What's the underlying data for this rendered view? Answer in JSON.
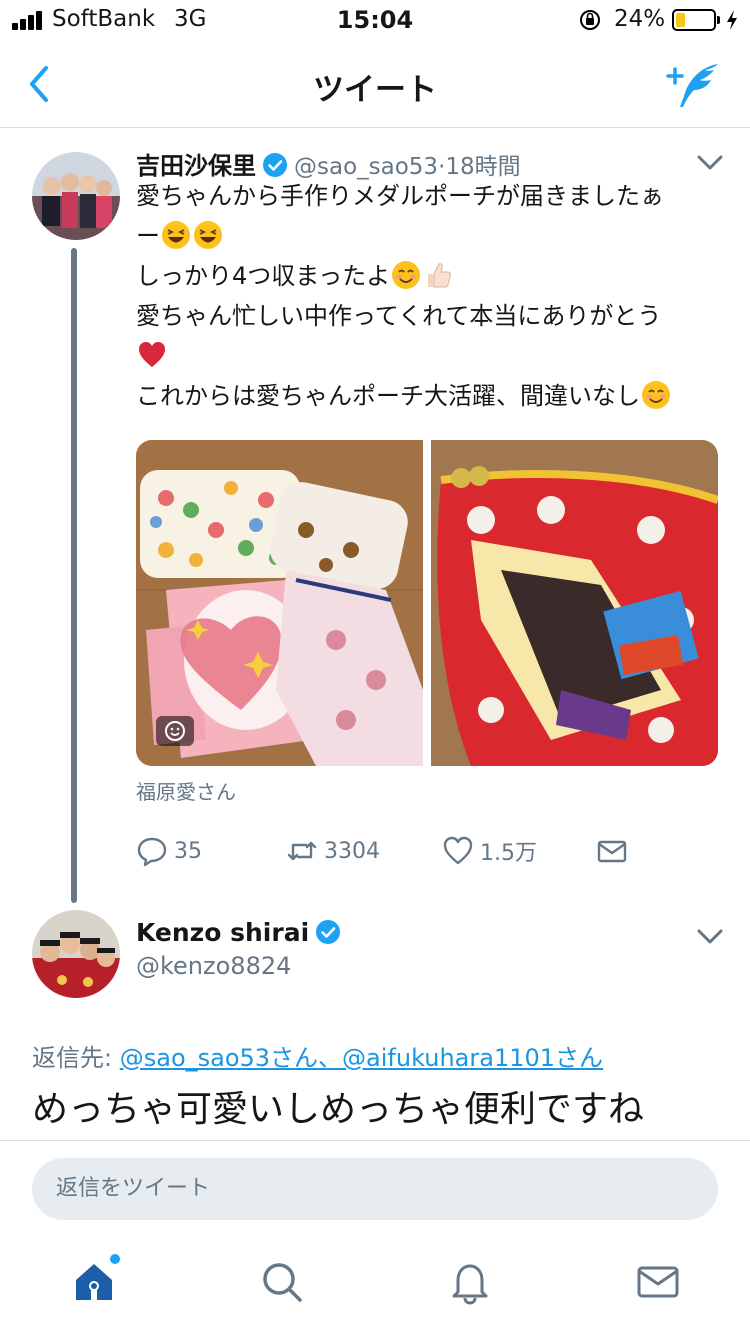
{
  "status_bar": {
    "carrier": "SoftBank",
    "network": "3G",
    "time": "15:04",
    "battery_percent": "24%",
    "battery_level": 0.24
  },
  "nav": {
    "title": "ツイート",
    "back_icon": "chevron-left-icon",
    "compose_icon": "compose-tweet-icon"
  },
  "tweet": {
    "author_name": "吉田沙保里",
    "handle": "@sao_sao53",
    "time_ago": "·18時間",
    "lines": [
      "愛ちゃんから手作りメダルポーチが届きましたぁ",
      "ー",
      "しっかり4つ収まったよ",
      "愛ちゃん忙しい中作ってくれて本当にありがとう",
      "",
      "これからは愛ちゃんポーチ大活躍、間違いなし"
    ],
    "tagged": "福原愛さん",
    "stats": {
      "replies": "35",
      "retweets": "3304",
      "likes": "1.5万"
    }
  },
  "reply": {
    "author_name": "Kenzo shirai",
    "handle": "@kenzo8824",
    "reply_to_label": "返信先:",
    "reply_to_mentions": "@sao_sao53さん、@aifukuhara1101さん",
    "text": "めっちゃ可愛いしめっちゃ便利ですね"
  },
  "compose": {
    "placeholder": "返信をツイート"
  },
  "tabs": [
    {
      "name": "home",
      "icon": "home-icon"
    },
    {
      "name": "search",
      "icon": "search-icon"
    },
    {
      "name": "notifications",
      "icon": "bell-icon"
    },
    {
      "name": "messages",
      "icon": "mail-icon"
    }
  ],
  "colors": {
    "accent": "#1da1f2",
    "muted": "#657786",
    "battery_fill": "#f5c518",
    "heart_emoji": "#d9263b"
  }
}
